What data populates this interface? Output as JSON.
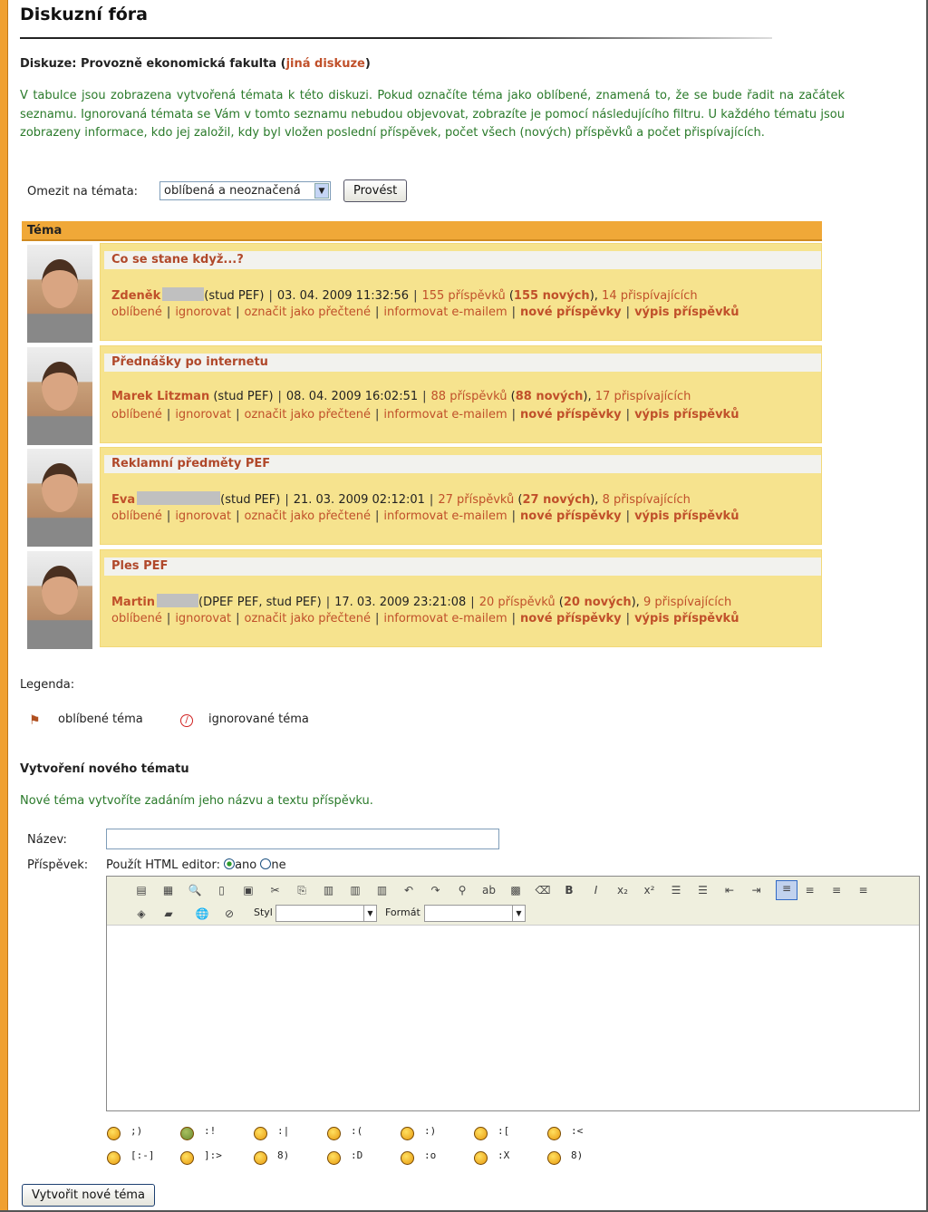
{
  "page_title": "Diskuzní fóra",
  "discussion": {
    "label": "Diskuze: Provozně ekonomická fakulta",
    "open": "(",
    "link": "jiná diskuze",
    "close": ")"
  },
  "intro": "V tabulce jsou zobrazena vytvořená témata k této diskuzi. Pokud označíte téma jako oblíbené, znamená to, že se bude řadit na začátek seznamu. Ignorovaná témata se Vám v tomto seznamu nebudou objevovat, zobrazíte je pomocí následujícího filtru. U každého tématu jsou zobrazeny informace, kdo jej založil, kdy byl vložen poslední příspěvek, počet všech (nových) příspěvků a počet přispívajících.",
  "filter": {
    "label": "Omezit na témata:",
    "value": "oblíbená a neoznačená",
    "submit": "Provést"
  },
  "table_header": "Téma",
  "actions": [
    "oblíbené",
    "ignorovat",
    "označit jako přečtené",
    "informovat e-mailem",
    "nové příspěvky",
    "výpis příspěvků"
  ],
  "topics": [
    {
      "title": "Co se stane když...?",
      "author": "Zdeněk",
      "role": "(stud PEF)",
      "date": "03. 04. 2009 11:32:56",
      "posts": "155 příspěvků",
      "new_open": "(",
      "new": "155 nových",
      "new_close": "),",
      "contributors": "14 přispívajících"
    },
    {
      "title": "Přednášky po internetu",
      "author": "Marek Litzman",
      "role": "(stud PEF)",
      "date": "08. 04. 2009 16:02:51",
      "posts": "88 příspěvků",
      "new_open": "(",
      "new": "88 nových",
      "new_close": "),",
      "contributors": "17 přispívajících"
    },
    {
      "title": "Reklamní předměty PEF",
      "author": "Eva",
      "role": "(stud PEF)",
      "date": "21. 03. 2009 02:12:01",
      "posts": "27 příspěvků",
      "new_open": "(",
      "new": "27 nových",
      "new_close": "),",
      "contributors": "8 přispívajících"
    },
    {
      "title": "Ples PEF",
      "author": "Martin",
      "role": "(DPEF PEF, stud PEF)",
      "date": "17. 03. 2009 23:21:08",
      "posts": "20 příspěvků",
      "new_open": "(",
      "new": "20 nových",
      "new_close": "),",
      "contributors": "9 přispívajících"
    }
  ],
  "legend": {
    "title": "Legenda:",
    "favorite": "oblíbené téma",
    "ignored": "ignorované téma"
  },
  "new_topic": {
    "heading": "Vytvoření nového tématu",
    "hint": "Nové téma vytvoříte zadáním jeho názvu a textu příspěvku.",
    "name_label": "Název:",
    "name_value": "",
    "post_label": "Příspěvek:",
    "html_editor_label": "Použít HTML editor:",
    "yes": "ano",
    "no": "ne",
    "style_label": "Styl",
    "format_label": "Formát",
    "submit": "Vytvořit nové téma"
  },
  "smileys": [
    ";)",
    ":!",
    ":|",
    ":(",
    ":)",
    ":[",
    ":<",
    "[:-]",
    "]:>",
    "8)",
    ":D",
    ":o",
    ":X",
    "8)"
  ]
}
